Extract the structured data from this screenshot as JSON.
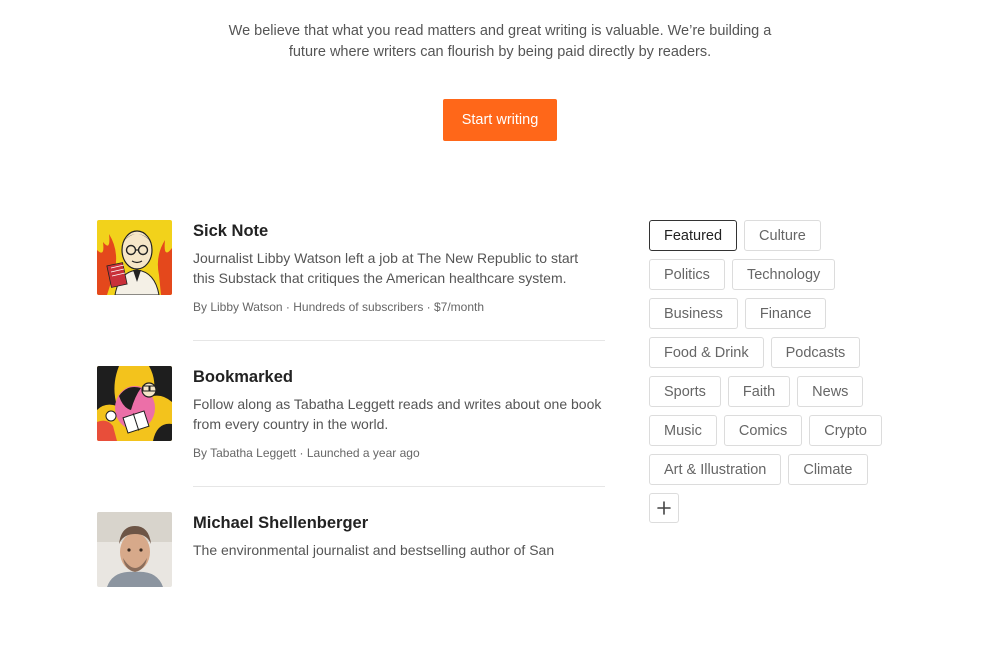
{
  "hero": {
    "tagline_line1": "We believe that what you read matters and great writing is valuable. We’re building a",
    "tagline_line2": "future where writers can flourish by being paid directly by readers.",
    "cta_label": "Start writing",
    "cta_color": "#ff6719"
  },
  "posts": [
    {
      "title": "Sick Note",
      "desc_line1": "Journalist Libby Watson left a job at The New Republic to start",
      "desc_line2": "this Substack that critiques the American healthcare system.",
      "meta": "By Libby Watson · Hundreds of subscribers · $7/month"
    },
    {
      "title": "Bookmarked",
      "desc_line1": "Follow along as Tabatha Leggett reads and writes about one book",
      "desc_line2": "from every country in the world.",
      "meta": "By Tabatha Leggett · Launched a year ago"
    },
    {
      "title": "Michael Shellenberger",
      "desc_line1": "The environmental journalist and bestselling author of San",
      "desc_line2": "",
      "meta": ""
    }
  ],
  "categories": {
    "rows": [
      [
        "Featured",
        "Culture"
      ],
      [
        "Politics",
        "Technology"
      ],
      [
        "Business",
        "Finance"
      ],
      [
        "Food & Drink",
        "Podcasts"
      ],
      [
        "Sports",
        "Faith",
        "News"
      ],
      [
        "Music",
        "Comics",
        "Crypto"
      ],
      [
        "Art & Illustration",
        "Climate"
      ]
    ],
    "active": "Featured",
    "add_icon": "plus-icon"
  }
}
